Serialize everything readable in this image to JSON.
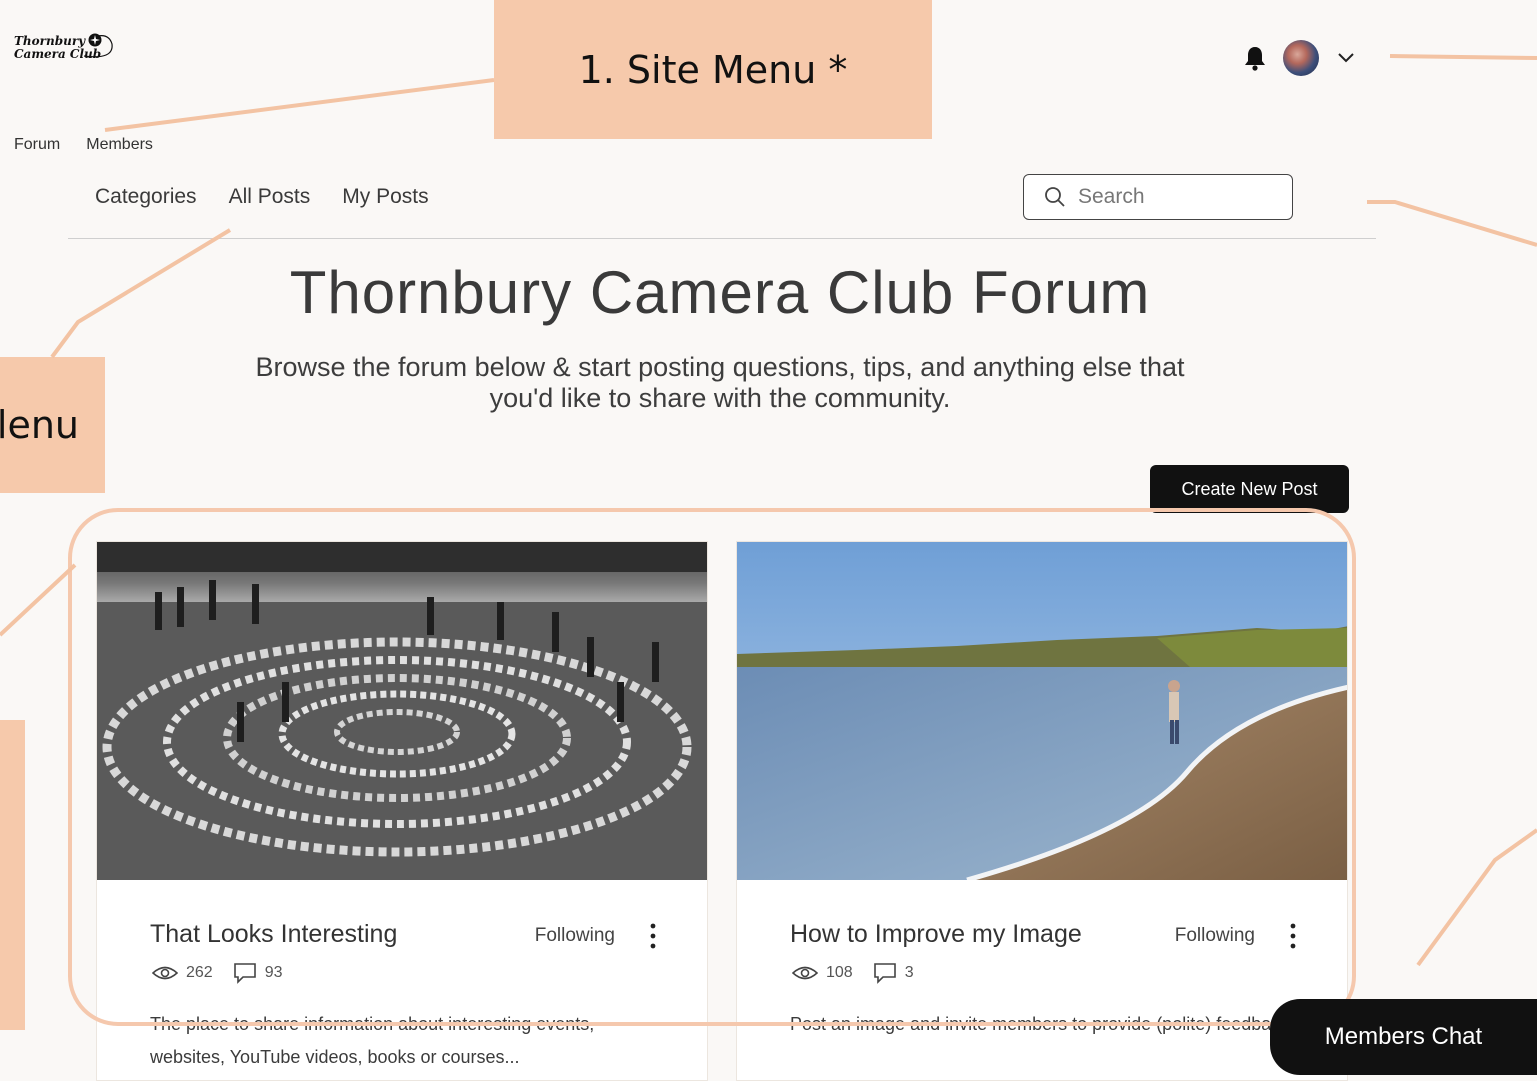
{
  "logo": {
    "line1": "Thornbury",
    "line2": "Camera Club"
  },
  "site_nav": {
    "items": [
      "Forum",
      "Members"
    ]
  },
  "callouts": {
    "site_menu": "1. Site Menu *",
    "left_menu_partial": "lenu"
  },
  "header_icons": {
    "bell": "bell-icon",
    "avatar": "user-avatar",
    "chevron": "chevron-down-icon"
  },
  "forum_nav": {
    "items": [
      "Categories",
      "All Posts",
      "My Posts"
    ]
  },
  "search": {
    "placeholder": "Search"
  },
  "forum": {
    "title": "Thornbury Camera Club Forum",
    "subtitle": "Browse the forum below & start posting questions, tips, and anything else that you'd like to share with the community."
  },
  "create_button": "Create New Post",
  "cards": [
    {
      "title": "That Looks Interesting",
      "follow": "Following",
      "views": "262",
      "comments": "93",
      "description": "The place to share information about interesting events, websites, YouTube videos, books or courses..."
    },
    {
      "title": "How to Improve my Image",
      "follow": "Following",
      "views": "108",
      "comments": "3",
      "description": "Post an image and invite members to provide (polite) feedback"
    }
  ],
  "chat_button": "Members Chat",
  "colors": {
    "callout": "#f6c9ab",
    "button": "#111111",
    "background": "#faf8f6"
  }
}
